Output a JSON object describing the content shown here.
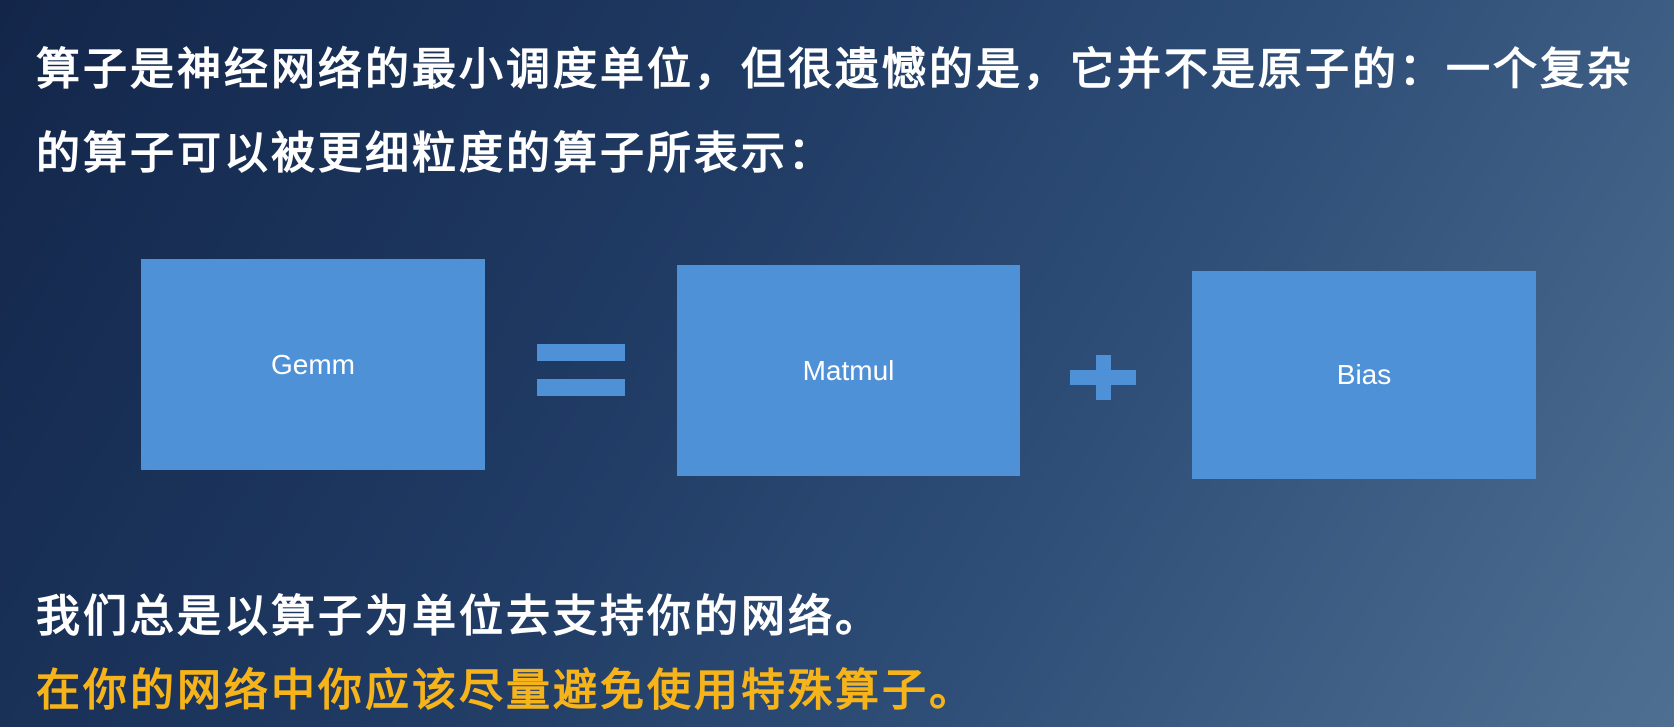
{
  "intro": {
    "text": "算子是神经网络的最小调度单位，但很遗憾的是，它并不是原子的：一个复杂的算子可以被更细粒度的算子所表示："
  },
  "diagram": {
    "lhs_label": "Gemm",
    "rhs_first_label": "Matmul",
    "rhs_second_label": "Bias",
    "box_color": "#4f91d7"
  },
  "notes": {
    "line1": "我们总是以算子为单位去支持你的网络。",
    "line2": "在你的网络中你应该尽量避免使用特殊算子。",
    "highlight_color": "#f6b31a"
  }
}
